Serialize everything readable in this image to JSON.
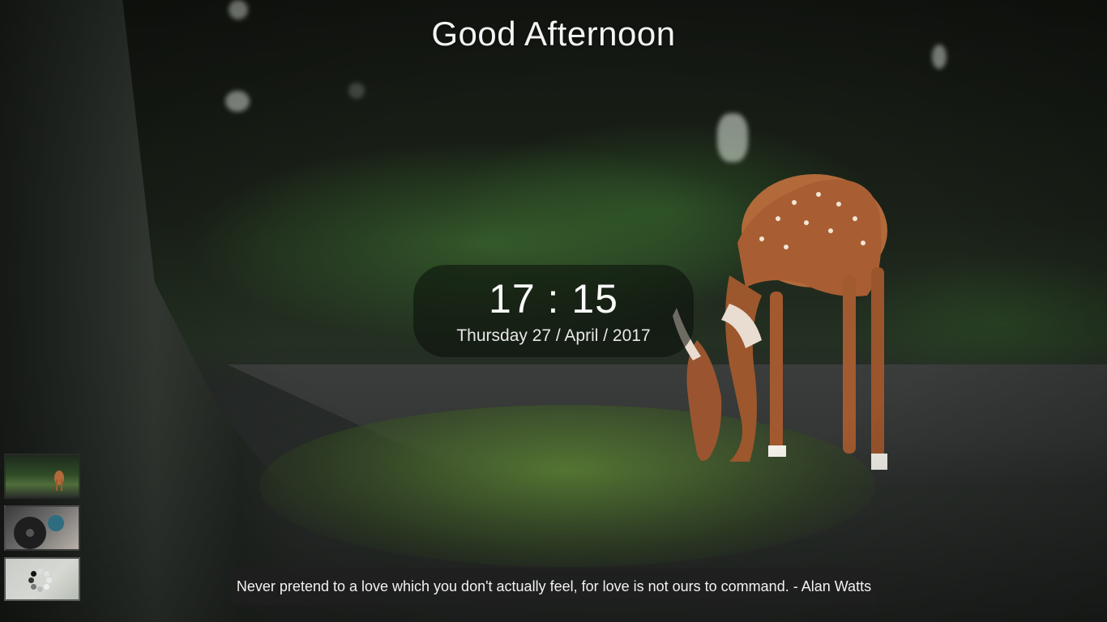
{
  "greeting": "Good Afternoon",
  "clock": {
    "time": "17 : 15",
    "date": "Thursday 27 / April / 2017"
  },
  "thumbnails": [
    {
      "icon": "deer-thumbnail",
      "selected": true
    },
    {
      "icon": "record-player-thumbnail",
      "selected": false
    },
    {
      "icon": "loading-spinner-icon",
      "selected": false
    }
  ],
  "quote": {
    "text": "Never pretend to a love which you don't actually feel, for love is not ours to command. - Alan Watts"
  },
  "colors": {
    "text": "#ffffff",
    "panel": "#0a0e0a",
    "quote_bar": "#1e1e1e"
  }
}
